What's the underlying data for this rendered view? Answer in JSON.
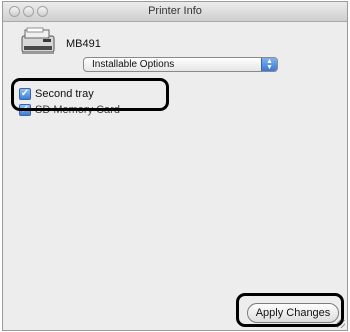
{
  "window": {
    "title": "Printer Info"
  },
  "printer": {
    "name": "MB491",
    "icon": "printer-icon"
  },
  "popup": {
    "selected": "Installable Options"
  },
  "options": [
    {
      "label": "Second tray",
      "checked": true
    },
    {
      "label": "SD Memory Card",
      "checked": true
    }
  ],
  "buttons": {
    "apply_label": "Apply Changes"
  },
  "colors": {
    "accent": "#3d7fd8",
    "window_bg": "#ededed"
  }
}
